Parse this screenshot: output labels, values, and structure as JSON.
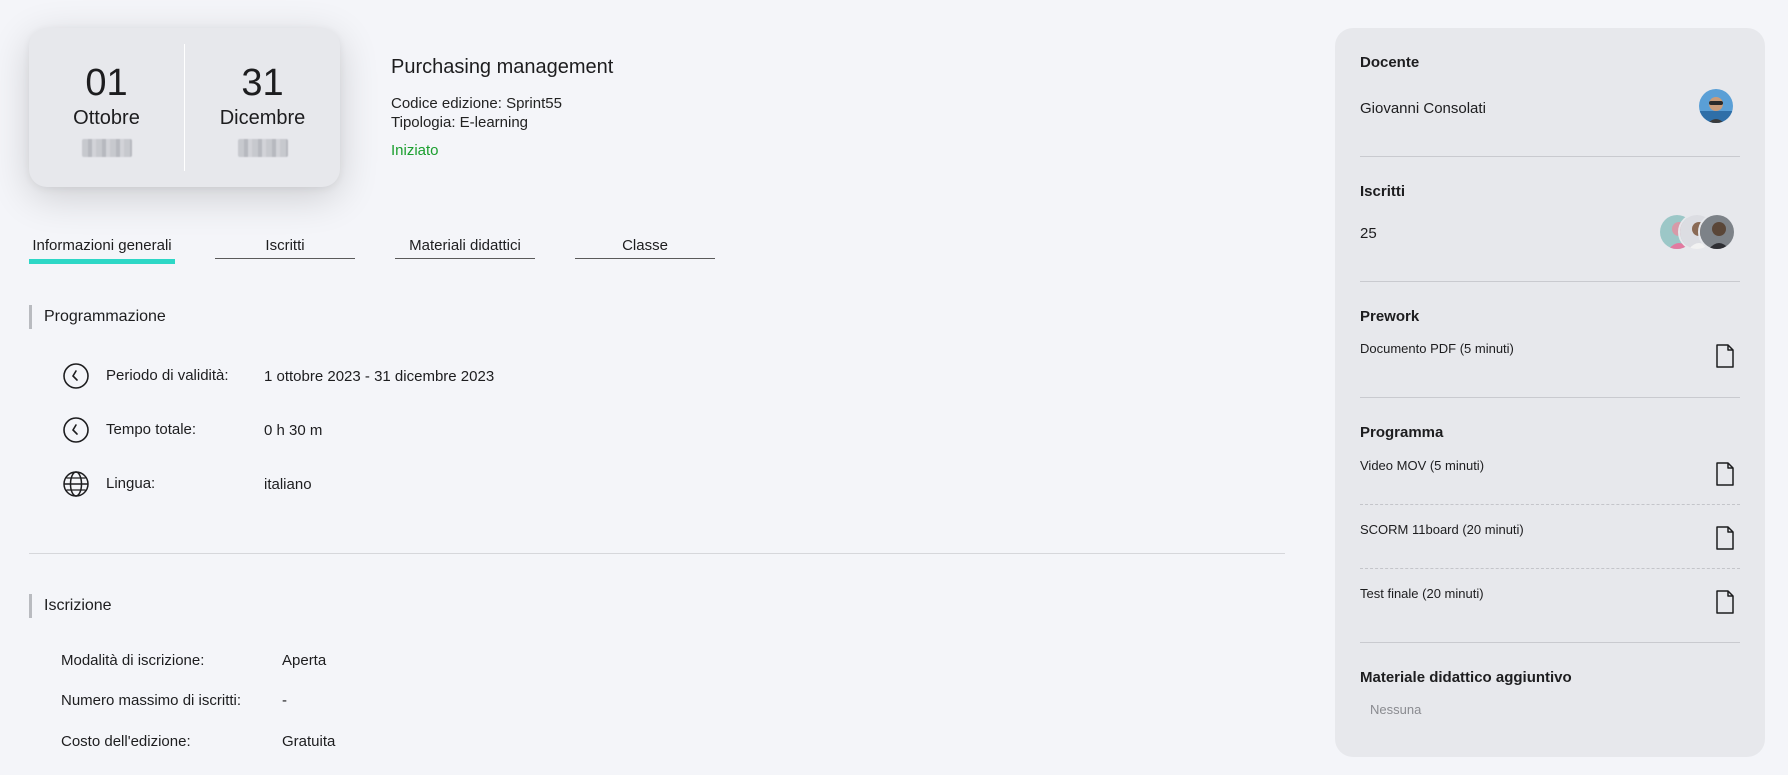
{
  "dates": {
    "start": {
      "day": "01",
      "month": "Ottobre"
    },
    "end": {
      "day": "31",
      "month": "Dicembre"
    }
  },
  "course": {
    "title": "Purchasing management",
    "code": "Codice edizione: Sprint55",
    "type": "Tipologia: E-learning",
    "status": "Iniziato"
  },
  "tabs": [
    {
      "label": "Informazioni generali",
      "active": true
    },
    {
      "label": "Iscritti"
    },
    {
      "label": "Materiali didattici"
    },
    {
      "label": "Classe"
    }
  ],
  "programmazione": {
    "title": "Programmazione",
    "rows": [
      {
        "icon": "clock-icon",
        "label": "Periodo di validità:",
        "value": "1 ottobre 2023 - 31 dicembre 2023"
      },
      {
        "icon": "clock-icon",
        "label": "Tempo totale:",
        "value": "0 h 30 m"
      },
      {
        "icon": "globe-icon",
        "label": "Lingua:",
        "value": "italiano"
      }
    ]
  },
  "iscrizione": {
    "title": "Iscrizione",
    "rows": [
      {
        "label": "Modalità di iscrizione:",
        "value": "Aperta"
      },
      {
        "label": "Numero massimo di iscritti:",
        "value": "-"
      },
      {
        "label": "Costo dell'edizione:",
        "value": "Gratuita"
      }
    ]
  },
  "panel": {
    "docente": {
      "title": "Docente",
      "name": "Giovanni Consolati"
    },
    "iscritti": {
      "title": "Iscritti",
      "count": "25"
    },
    "prework": {
      "title": "Prework",
      "items": [
        "Documento PDF (5 minuti)"
      ]
    },
    "programma": {
      "title": "Programma",
      "items": [
        "Video MOV (5 minuti)",
        "SCORM 11board (20 minuti)",
        "Test finale (20 minuti)"
      ]
    },
    "materiale": {
      "title": "Materiale didattico aggiuntivo",
      "value": "Nessuna"
    }
  },
  "colors": {
    "accent": "#2dd7c6",
    "status": "#1a9e2e"
  }
}
